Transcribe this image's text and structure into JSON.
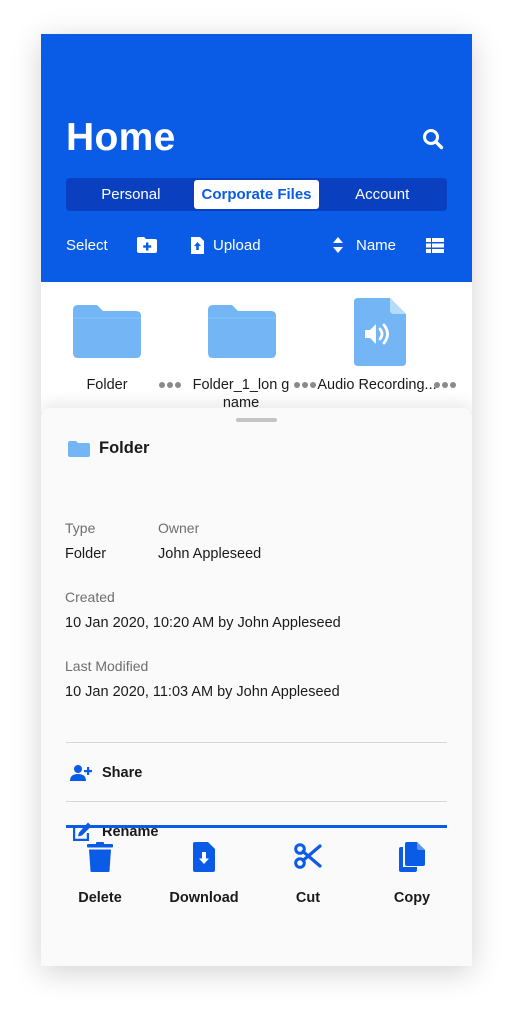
{
  "header": {
    "title": "Home",
    "search_icon": "search-icon",
    "tabs": [
      {
        "label": "Personal",
        "active": false
      },
      {
        "label": "Corporate Files",
        "active": true
      },
      {
        "label": "Account",
        "active": false
      }
    ],
    "toolbar": {
      "select_label": "Select",
      "new_folder_icon": "folder-plus-icon",
      "upload_label": "Upload",
      "upload_icon": "upload-icon",
      "sort_label": "Name",
      "sort_icon": "sort-icon",
      "view_icon": "list-view-icon"
    }
  },
  "files": [
    {
      "name": "Folder",
      "type": "folder",
      "icon": "folder-icon"
    },
    {
      "name": "Folder_1_lon g name",
      "type": "folder",
      "icon": "folder-icon"
    },
    {
      "name": "Audio Recording...",
      "type": "audio",
      "icon": "audio-file-icon"
    }
  ],
  "details": {
    "title": "Folder",
    "title_icon": "folder-icon",
    "type_label": "Type",
    "type_value": "Folder",
    "owner_label": "Owner",
    "owner_value": "John Appleseed",
    "created_label": "Created",
    "created_value": "10 Jan 2020, 10:20 AM by John Appleseed",
    "modified_label": "Last Modified",
    "modified_value": "10 Jan 2020, 11:03 AM by John Appleseed"
  },
  "actions": {
    "share_label": "Share",
    "rename_label": "Rename",
    "bottom": [
      {
        "label": "Delete",
        "icon": "trash-icon"
      },
      {
        "label": "Download",
        "icon": "download-icon"
      },
      {
        "label": "Cut",
        "icon": "scissors-icon"
      },
      {
        "label": "Copy",
        "icon": "copy-icon"
      }
    ]
  },
  "colors": {
    "accent": "#0a5ce6",
    "accent_dark": "#0a3fbf",
    "folder": "#74b6f5"
  }
}
